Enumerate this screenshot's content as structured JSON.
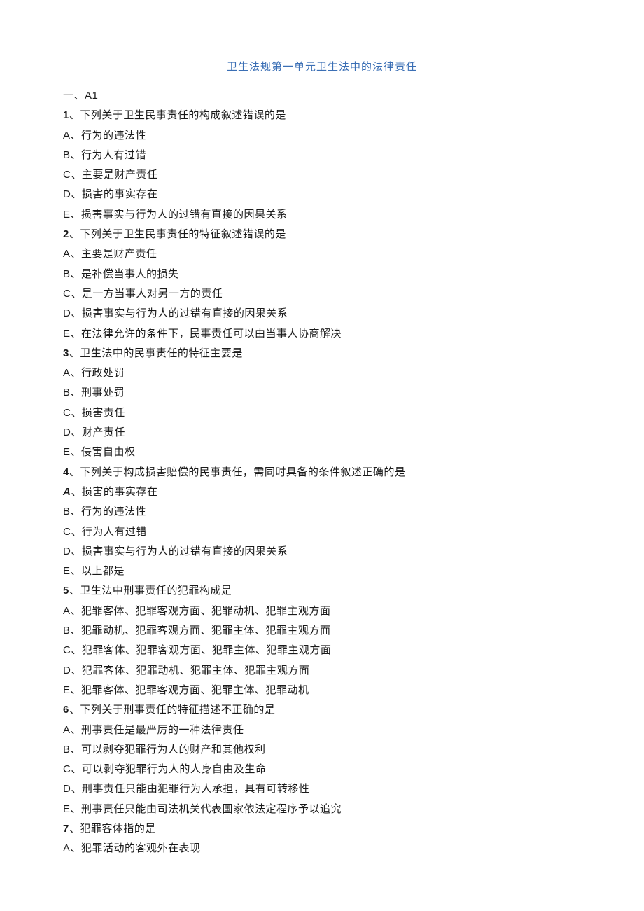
{
  "title": "卫生法规第一单元卫生法中的法律责任",
  "section_header": "一、A1",
  "questions": [
    {
      "num": "1",
      "stem": "下列关于卫生民事责任的构成叙述错误的是",
      "options": [
        "A、行为的违法性",
        "B、行为人有过错",
        "C、主要是财产责任",
        "D、损害的事实存在",
        "E、损害事实与行为人的过错有直接的因果关系"
      ]
    },
    {
      "num": "2",
      "stem": "下列关于卫生民事责任的特征叙述错误的是",
      "options": [
        "A、主要是财产责任",
        "B、是补偿当事人的损失",
        "C、是一方当事人对另一方的责任",
        "D、损害事实与行为人的过错有直接的因果关系",
        "E、在法律允许的条件下，民事责任可以由当事人协商解决"
      ]
    },
    {
      "num": "3",
      "stem": "卫生法中的民事责任的特征主要是",
      "options": [
        "A、行政处罚",
        "B、刑事处罚",
        "C、损害责任",
        "D、财产责任",
        "E、侵害自由权"
      ]
    },
    {
      "num": "4",
      "stem": "下列关于构成损害赔偿的民事责任，需同时具备的条件叙述正确的是",
      "first_option_italic": true,
      "options": [
        "A、损害的事实存在",
        "B、行为的违法性",
        "C、行为人有过错",
        "D、损害事实与行为人的过错有直接的因果关系",
        "E、以上都是"
      ]
    },
    {
      "num": "5",
      "stem": "卫生法中刑事责任的犯罪构成是",
      "options": [
        "A、犯罪客体、犯罪客观方面、犯罪动机、犯罪主观方面",
        "B、犯罪动机、犯罪客观方面、犯罪主体、犯罪主观方面",
        "C、犯罪客体、犯罪客观方面、犯罪主体、犯罪主观方面",
        "D、犯罪客体、犯罪动机、犯罪主体、犯罪主观方面",
        "E、犯罪客体、犯罪客观方面、犯罪主体、犯罪动机"
      ]
    },
    {
      "num": "6",
      "stem": "下列关于刑事责任的特征描述不正确的是",
      "options": [
        "A、刑事责任是最严厉的一种法律责任",
        "B、可以剥夺犯罪行为人的财产和其他权利",
        "C、可以剥夺犯罪行为人的人身自由及生命",
        "D、刑事责任只能由犯罪行为人承担，具有可转移性",
        "E、刑事责任只能由司法机关代表国家依法定程序予以追究"
      ]
    },
    {
      "num": "7",
      "stem": "犯罪客体指的是",
      "options": [
        "A、犯罪活动的客观外在表现"
      ]
    }
  ]
}
